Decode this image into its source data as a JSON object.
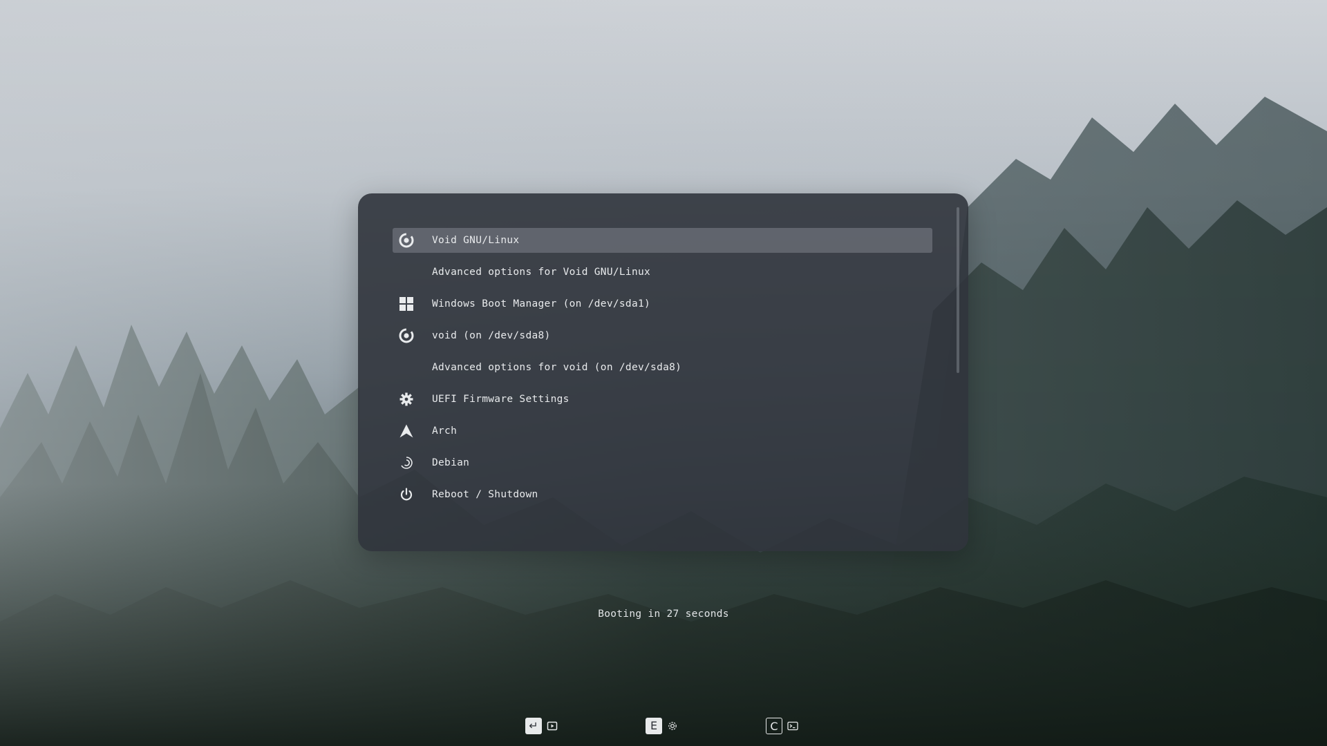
{
  "boot_menu": {
    "selected_index": 0,
    "entries": [
      {
        "label": "Void GNU/Linux",
        "icon": "void-icon",
        "selected": true
      },
      {
        "label": "Advanced options for Void GNU/Linux",
        "icon": "",
        "selected": false
      },
      {
        "label": "Windows Boot Manager (on /dev/sda1)",
        "icon": "windows-icon",
        "selected": false
      },
      {
        "label": "void (on /dev/sda8)",
        "icon": "void-icon",
        "selected": false
      },
      {
        "label": "Advanced options for void (on /dev/sda8)",
        "icon": "",
        "selected": false
      },
      {
        "label": "UEFI Firmware Settings",
        "icon": "gear-icon",
        "selected": false
      },
      {
        "label": "Arch",
        "icon": "arch-icon",
        "selected": false
      },
      {
        "label": "Debian",
        "icon": "debian-icon",
        "selected": false
      },
      {
        "label": "Reboot / Shutdown",
        "icon": "power-icon",
        "selected": false
      }
    ]
  },
  "countdown": {
    "text": "Booting in 27 seconds"
  },
  "hints": [
    {
      "key": "↵",
      "icon": "boot-icon",
      "style": "filled"
    },
    {
      "key": "E",
      "icon": "gear-icon",
      "style": "filled"
    },
    {
      "key": "C",
      "icon": "terminal-icon",
      "style": "outline"
    }
  ],
  "colors": {
    "panel": "#30343c",
    "selection": "#7d828a",
    "text": "#e9ebed"
  }
}
